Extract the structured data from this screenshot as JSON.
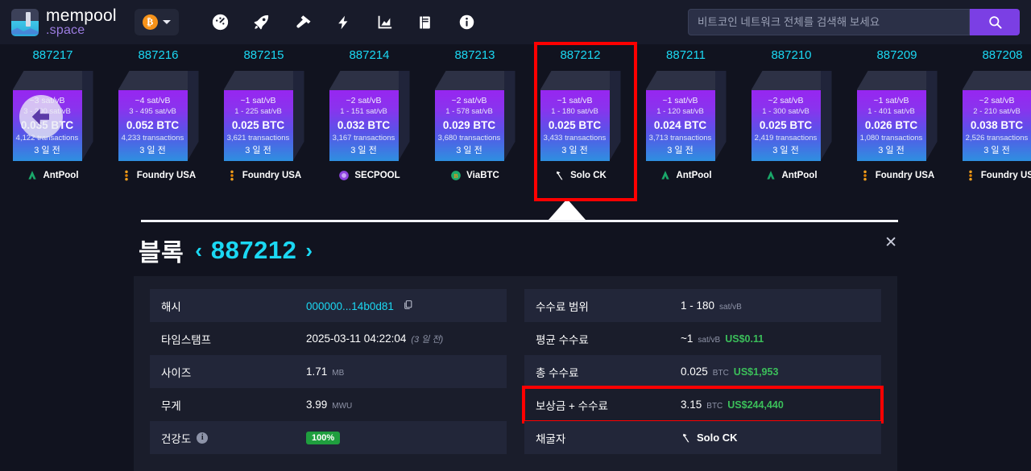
{
  "nav": {
    "brand_line1": "mempool",
    "brand_line2": ".space",
    "coin_symbol": "₿",
    "icons": [
      {
        "name": "dashboard-icon",
        "label": "Dashboard"
      },
      {
        "name": "rocket-icon",
        "label": "Accelerator"
      },
      {
        "name": "hammer-icon",
        "label": "Mining"
      },
      {
        "name": "lightning-icon",
        "label": "Lightning"
      },
      {
        "name": "chart-icon",
        "label": "Graphs"
      },
      {
        "name": "book-icon",
        "label": "Docs"
      },
      {
        "name": "info-icon",
        "label": "About"
      }
    ]
  },
  "search": {
    "placeholder": "비트코인 네트워크 전체를 검색해 보세요",
    "value": "",
    "button_icon": "search-icon"
  },
  "blocks": [
    {
      "height": "887217",
      "avg_fee": "~3 sat/vB",
      "fee_range": "3 - 200 sat/vB",
      "reward": "0.035 BTC",
      "tx_count": "4,122 transactions",
      "age": "3 일 전",
      "pool": "AntPool",
      "pool_icon": "antpool-icon",
      "selected": false,
      "has_back_arrow": true
    },
    {
      "height": "887216",
      "avg_fee": "~4 sat/vB",
      "fee_range": "3 - 495 sat/vB",
      "reward": "0.052 BTC",
      "tx_count": "4,233 transactions",
      "age": "3 일 전",
      "pool": "Foundry USA",
      "pool_icon": "foundry-icon",
      "selected": false,
      "has_back_arrow": false
    },
    {
      "height": "887215",
      "avg_fee": "~1 sat/vB",
      "fee_range": "1 - 225 sat/vB",
      "reward": "0.025 BTC",
      "tx_count": "3,621 transactions",
      "age": "3 일 전",
      "pool": "Foundry USA",
      "pool_icon": "foundry-icon",
      "selected": false,
      "has_back_arrow": false
    },
    {
      "height": "887214",
      "avg_fee": "~2 sat/vB",
      "fee_range": "1 - 151 sat/vB",
      "reward": "0.032 BTC",
      "tx_count": "3,167 transactions",
      "age": "3 일 전",
      "pool": "SECPOOL",
      "pool_icon": "secpool-icon",
      "selected": false,
      "has_back_arrow": false
    },
    {
      "height": "887213",
      "avg_fee": "~2 sat/vB",
      "fee_range": "1 - 578 sat/vB",
      "reward": "0.029 BTC",
      "tx_count": "3,680 transactions",
      "age": "3 일 전",
      "pool": "ViaBTC",
      "pool_icon": "viabtc-icon",
      "selected": false,
      "has_back_arrow": false
    },
    {
      "height": "887212",
      "avg_fee": "~1 sat/vB",
      "fee_range": "1 - 180 sat/vB",
      "reward": "0.025 BTC",
      "tx_count": "3,433 transactions",
      "age": "3 일 전",
      "pool": "Solo CK",
      "pool_icon": "solock-icon",
      "selected": true,
      "has_back_arrow": false
    },
    {
      "height": "887211",
      "avg_fee": "~1 sat/vB",
      "fee_range": "1 - 120 sat/vB",
      "reward": "0.024 BTC",
      "tx_count": "3,713 transactions",
      "age": "3 일 전",
      "pool": "AntPool",
      "pool_icon": "antpool-icon",
      "selected": false,
      "has_back_arrow": false
    },
    {
      "height": "887210",
      "avg_fee": "~2 sat/vB",
      "fee_range": "1 - 300 sat/vB",
      "reward": "0.025 BTC",
      "tx_count": "2,419 transactions",
      "age": "3 일 전",
      "pool": "AntPool",
      "pool_icon": "antpool-icon",
      "selected": false,
      "has_back_arrow": false
    },
    {
      "height": "887209",
      "avg_fee": "~1 sat/vB",
      "fee_range": "1 - 401 sat/vB",
      "reward": "0.026 BTC",
      "tx_count": "1,080 transactions",
      "age": "3 일 전",
      "pool": "Foundry USA",
      "pool_icon": "foundry-icon",
      "selected": false,
      "has_back_arrow": false
    },
    {
      "height": "887208",
      "avg_fee": "~2 sat/vB",
      "fee_range": "2 - 210 sat/vB",
      "reward": "0.038 BTC",
      "tx_count": "2,526 transactions",
      "age": "3 일 전",
      "pool": "Foundry USA",
      "pool_icon": "foundry-icon",
      "selected": false,
      "has_back_arrow": false
    }
  ],
  "detail": {
    "title": "블록",
    "prev_chevron": "‹",
    "next_chevron": "›",
    "block_number": "887212",
    "close_label": "✕",
    "left_rows": [
      {
        "label": "해시",
        "value": "000000...14b0d81",
        "type": "hash"
      },
      {
        "label": "타임스탬프",
        "value": "2025-03-11 04:22:04",
        "ago": "(3 일 전)",
        "type": "timestamp"
      },
      {
        "label": "사이즈",
        "value": "1.71",
        "unit": "MB",
        "type": "plain"
      },
      {
        "label": "무게",
        "value": "3.99",
        "unit": "MWU",
        "type": "plain"
      },
      {
        "label": "건강도",
        "value": "100%",
        "type": "badge",
        "has_info": true
      }
    ],
    "right_rows": [
      {
        "label": "수수료 범위",
        "value": "1 - 180",
        "unit": "sat/vB",
        "type": "plain"
      },
      {
        "label": "평균 수수료",
        "value": "~1",
        "unit": "sat/vB",
        "usd": "US$0.11",
        "type": "plain"
      },
      {
        "label": "총 수수료",
        "value": "0.025",
        "unit": "BTC",
        "usd": "US$1,953",
        "type": "plain"
      },
      {
        "label": "보상금 + 수수료",
        "value": "3.15",
        "unit": "BTC",
        "usd": "US$244,440",
        "type": "plain",
        "highlight": true
      },
      {
        "label": "채굴자",
        "value": "Solo CK",
        "type": "miner",
        "pool_icon": "solock-icon"
      }
    ]
  },
  "colors": {
    "accent_cyan": "#1bd8f3",
    "accent_purple": "#7b3fe4",
    "usd_green": "#3bbf5a",
    "highlight_red": "#ff0000",
    "bg": "#11131f",
    "panel": "#1a1d2b"
  }
}
